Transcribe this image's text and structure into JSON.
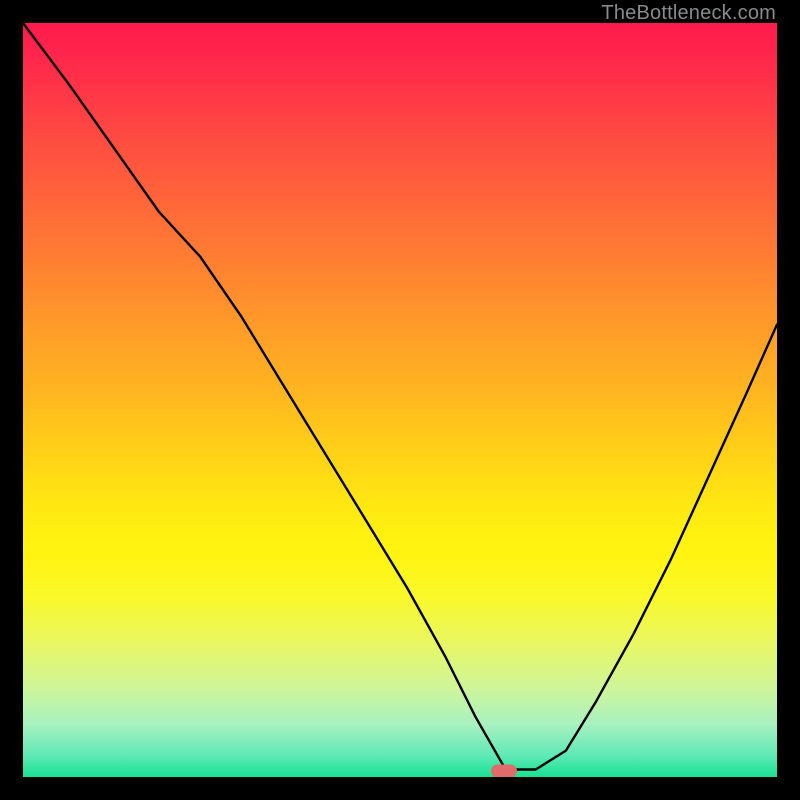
{
  "watermark": "TheBottleneck.com",
  "marker": {
    "x_frac": 0.638,
    "y_frac": 0.992,
    "color": "#e16a6a"
  },
  "chart_data": {
    "type": "line",
    "title": "",
    "xlabel": "",
    "ylabel": "",
    "xlim": [
      0,
      1
    ],
    "ylim": [
      0,
      1
    ],
    "series": [
      {
        "name": "bottleneck-curve",
        "x": [
          0.0,
          0.06,
          0.12,
          0.18,
          0.235,
          0.29,
          0.345,
          0.4,
          0.455,
          0.51,
          0.56,
          0.6,
          0.64,
          0.68,
          0.72,
          0.76,
          0.81,
          0.86,
          0.91,
          0.96,
          1.0
        ],
        "y": [
          1.0,
          0.92,
          0.835,
          0.75,
          0.69,
          0.61,
          0.52,
          0.43,
          0.34,
          0.25,
          0.16,
          0.08,
          0.01,
          0.01,
          0.035,
          0.1,
          0.19,
          0.29,
          0.4,
          0.51,
          0.6
        ]
      }
    ],
    "annotations": [
      {
        "type": "marker",
        "x": 0.638,
        "y": 0.008,
        "shape": "rounded-rect",
        "color": "#e16a6a"
      }
    ],
    "background_gradient": {
      "direction": "vertical",
      "stops": [
        {
          "pos": 0.0,
          "color": "#ff1a4d"
        },
        {
          "pos": 0.5,
          "color": "#ffb91f"
        },
        {
          "pos": 0.7,
          "color": "#fff40f"
        },
        {
          "pos": 1.0,
          "color": "#18e293"
        }
      ]
    }
  }
}
